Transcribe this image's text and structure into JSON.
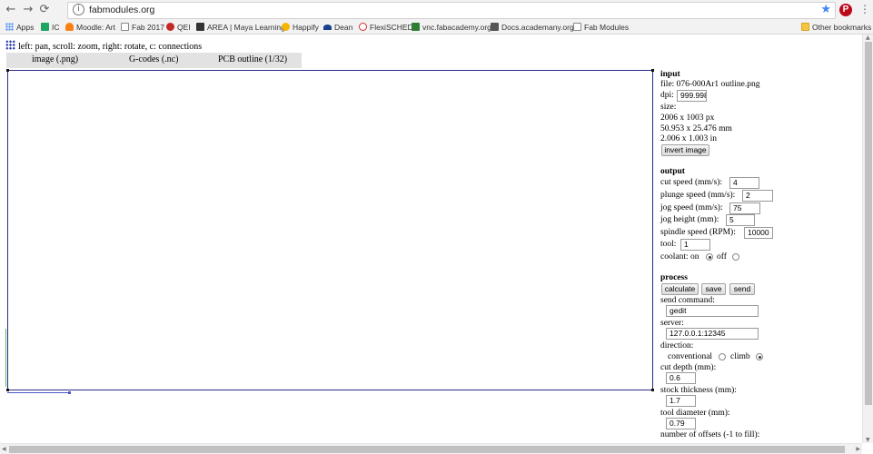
{
  "browser": {
    "url": "fabmodules.org",
    "nav": {
      "back_icon": "←",
      "forward_icon": "→",
      "reload_icon": "⟳"
    },
    "bookmarks": [
      {
        "label": "Apps",
        "icon": "apps-grid-icon",
        "color": "#4285f4"
      },
      {
        "label": "IC",
        "icon": "classroom-icon",
        "color": "#1fa463"
      },
      {
        "label": "Moodle: Art",
        "icon": "moodle-icon",
        "color": "#f98012"
      },
      {
        "label": "Fab 2017",
        "icon": "doc-icon",
        "color": "#888888"
      },
      {
        "label": "QEI",
        "icon": "qei-icon",
        "color": "#c62828"
      },
      {
        "label": "AREA | Maya Learning",
        "icon": "area-icon",
        "color": "#333333"
      },
      {
        "label": "Happify",
        "icon": "happify-icon",
        "color": "#f4b400"
      },
      {
        "label": "Dean",
        "icon": "dean-icon",
        "color": "#1a3f8f"
      },
      {
        "label": "FlexiSCHED",
        "icon": "flexisched-icon",
        "color": "#d32f2f"
      },
      {
        "label": "vnc.fabacademy.org",
        "icon": "vnc-icon",
        "color": "#2e7d32"
      },
      {
        "label": "Docs.academany.org",
        "icon": "docs-icon",
        "color": "#555555"
      },
      {
        "label": "Fab Modules",
        "icon": "doc-icon",
        "color": "#888888"
      }
    ],
    "other_bookmarks": "Other bookmarks"
  },
  "page": {
    "hint": "left: pan, scroll: zoom, right: rotate, c: connections",
    "tabs": [
      "image (.png)",
      "G-codes (.nc)",
      "PCB outline (1/32)"
    ]
  },
  "input": {
    "heading": "input",
    "file_label": "file: 076-000Ar1 outline.png",
    "dpi_label": "dpi:",
    "dpi_value": "999.998",
    "size_label": "size:",
    "size_px": "2006 x 1003 px",
    "size_mm": "50.953 x 25.476 mm",
    "size_in": "2.006 x 1.003 in",
    "invert_button": "invert image"
  },
  "output": {
    "heading": "output",
    "cut_speed_label": "cut speed (mm/s):",
    "cut_speed": "4",
    "plunge_speed_label": "plunge speed (mm/s):",
    "plunge_speed": "2",
    "jog_speed_label": "jog speed (mm/s):",
    "jog_speed": "75",
    "jog_height_label": "jog height (mm):",
    "jog_height": "5",
    "spindle_label": "spindle speed (RPM):",
    "spindle": "10000",
    "tool_label": "tool:",
    "tool": "1",
    "coolant_label": "coolant: on",
    "coolant_off_label": "off",
    "coolant_state": "on"
  },
  "process": {
    "heading": "process",
    "calculate": "calculate",
    "save": "save",
    "send": "send",
    "send_command_label": "send command:",
    "send_command": "gedit",
    "server_label": "server:",
    "server": "127.0.0.1:12345",
    "direction_label": "direction:",
    "conventional_label": "conventional",
    "climb_label": "climb",
    "direction_state": "climb",
    "cut_depth_label": "cut depth (mm):",
    "cut_depth": "0.6",
    "stock_label": "stock thickness (mm):",
    "stock": "1.7",
    "tool_diameter_label": "tool diameter (mm):",
    "tool_diameter": "0.79",
    "offsets_label": "number of offsets (-1 to fill):"
  }
}
